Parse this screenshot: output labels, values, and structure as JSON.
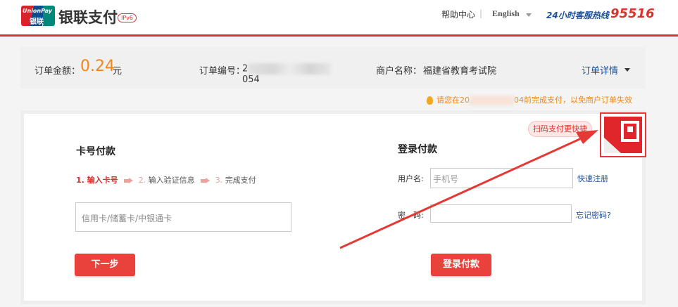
{
  "header": {
    "logo_text_en": "UnionPay",
    "logo_text_cn": "银联",
    "brand": "银联支付",
    "ipv6_badge": "IPv6",
    "help_link": "帮助中心",
    "separator": "|",
    "language": "English",
    "hotline_label": "24小时客服热线",
    "hotline_number": "95516"
  },
  "order": {
    "amount_label": "订单金额：",
    "amount": "0.24",
    "amount_unit": "元",
    "order_no_label": "订单编号：",
    "order_no_prefix": "2",
    "order_no_suffix": "054",
    "merchant_label": "商户名称：",
    "merchant": "福建省教育考试院",
    "detail_link": "订单详情"
  },
  "notice": {
    "text_prefix": "请您在20",
    "text_suffix": "04前完成支付，以免商户订单失效"
  },
  "card_pay": {
    "title": "卡号付款",
    "steps": [
      {
        "num": "1.",
        "label": "输入卡号"
      },
      {
        "num": "2.",
        "label": "输入验证信息"
      },
      {
        "num": "3.",
        "label": "完成支付"
      }
    ],
    "card_placeholder": "信用卡/储蓄卡/中银通卡",
    "next_button": "下一步"
  },
  "login_pay": {
    "title": "登录付款",
    "username_label": "用户名:",
    "username_placeholder": "手机号",
    "register_link": "快速注册",
    "password_label": "密　码:",
    "forgot_link": "忘记密码?",
    "login_button": "登录付款"
  },
  "qr": {
    "tip": "扫码支付更快捷"
  },
  "colors": {
    "accent_red": "#d9332e",
    "amount_orange": "#f08519",
    "link_blue": "#1a4f9c",
    "annotation_arrow": "#e53935"
  }
}
